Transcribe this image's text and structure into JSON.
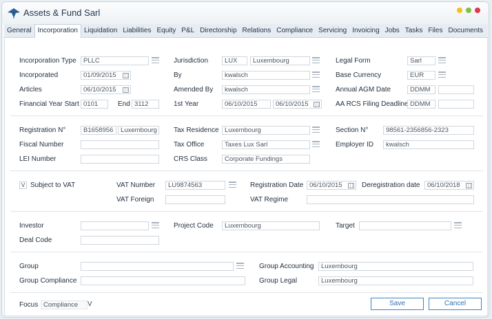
{
  "app": {
    "title": "Assets & Fund Sarl"
  },
  "tabs": [
    "General",
    "Incorporation",
    "Liquidation",
    "Liabilities",
    "Equity",
    "P&L",
    "Directorship",
    "Relations",
    "Compliance",
    "Servicing",
    "Invoicing",
    "Jobs",
    "Tasks",
    "Files",
    "Documents"
  ],
  "incorporation": {
    "incorporation_type_label": "Incorporation Type",
    "incorporation_type": "PLLC",
    "jurisdiction_label": "Jurisdiction",
    "jurisdiction_code": "LUX",
    "jurisdiction_name": "Luxembourg",
    "legal_form_label": "Legal Form",
    "legal_form": "Sarl",
    "incorporated_label": "Incorporated",
    "incorporated": "01/09/2015",
    "by_label": "By",
    "by": "kwalsch",
    "base_currency_label": "Base Currency",
    "base_currency": "EUR",
    "articles_label": "Articles",
    "articles": "06/10/2015",
    "amended_by_label": "Amended By",
    "amended_by": "kwalsch",
    "agm_label": "Annual AGM Date",
    "agm": "DDMM",
    "agm_extra": "",
    "fy_start_label": "Financial Year Start",
    "fy_start": "0101",
    "end_label": "End",
    "end": "3112",
    "first_year_label": "1st Year",
    "first_year_from": "06/10/2015",
    "first_year_to": "06/10/2015",
    "rcs_label": "AA RCS Filing Deadline",
    "rcs": "DDMM",
    "rcs_extra": ""
  },
  "registration": {
    "reg_no_label": "Registration N°",
    "reg_no": "B1658956",
    "reg_place": "Luxembourg",
    "tax_residence_label": "Tax Residence",
    "tax_residence": "Luxembourg",
    "section_label": "Section N°",
    "section": "98561-2356856-2323",
    "fiscal_label": "Fiscal Number",
    "fiscal": "",
    "tax_office_label": "Tax Office",
    "tax_office": "Taxes Lux Sarl",
    "employer_label": "Employer ID",
    "employer": "kwalsch",
    "lei_label": "LEI Number",
    "lei": "",
    "crs_label": "CRS Class",
    "crs": "Corporate Fundings"
  },
  "vat": {
    "checkbox_mark": "V",
    "subject_label": "Subject to VAT",
    "number_label": "VAT Number",
    "number": "LU9874563",
    "reg_date_label": "Registration Date",
    "reg_date": "06/10/2015",
    "dereg_label": "Deregistration date",
    "dereg_date": "06/10/2018",
    "foreign_label": "VAT Foreign",
    "foreign": "",
    "regime_label": "VAT Regime",
    "regime": ""
  },
  "investor": {
    "investor_label": "Investor",
    "investor": "",
    "project_label": "Project Code",
    "project": "Luxembourg",
    "target_label": "Target",
    "target": "",
    "deal_label": "Deal Code",
    "deal": ""
  },
  "group": {
    "group_label": "Group",
    "group": "",
    "accounting_label": "Group Accounting",
    "accounting": "Luxembourg",
    "compliance_label": "Group Compliance",
    "compliance": "",
    "legal_label": "Group Legal",
    "legal": "Luxembourg"
  },
  "footer": {
    "focus_label": "Focus",
    "focus_value": "Compliance",
    "focus_arrow": "V",
    "save": "Save",
    "cancel": "Cancel"
  }
}
